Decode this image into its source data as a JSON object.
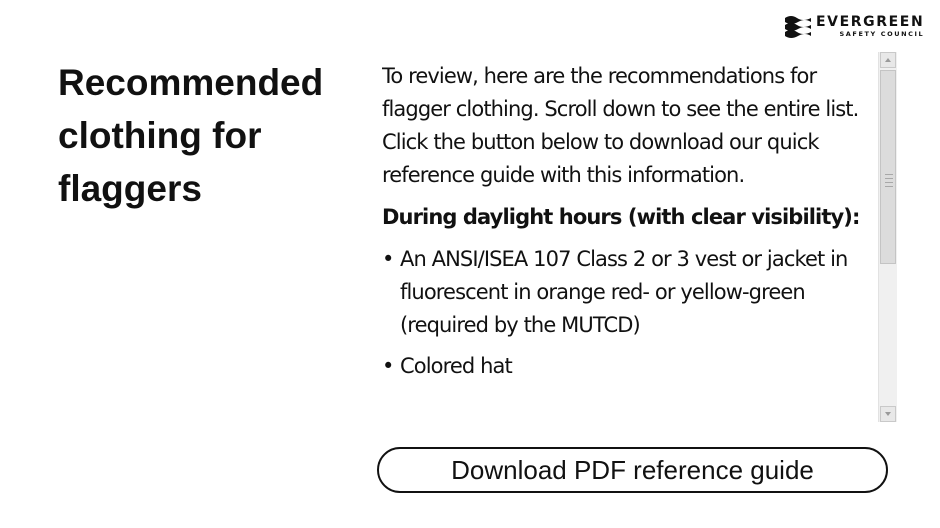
{
  "logo": {
    "name": "EVERGREEN",
    "subtitle": "SAFETY COUNCIL"
  },
  "heading": "Recommended clothing for flaggers",
  "panel": {
    "intro": "To review, here are the recommendations for flagger clothing. Scroll down to see the entire list. Click the button below to download our quick reference guide with this information.",
    "subheading": "During daylight hours (with clear visibility):",
    "bullet_char": "•",
    "items": [
      "An ANSI/ISEA 107 Class 2 or 3 vest or jacket in fluorescent in orange red- or yellow-green (required by the MUTCD)",
      "Colored hat"
    ]
  },
  "download_button": {
    "label": "Download PDF reference guide"
  }
}
